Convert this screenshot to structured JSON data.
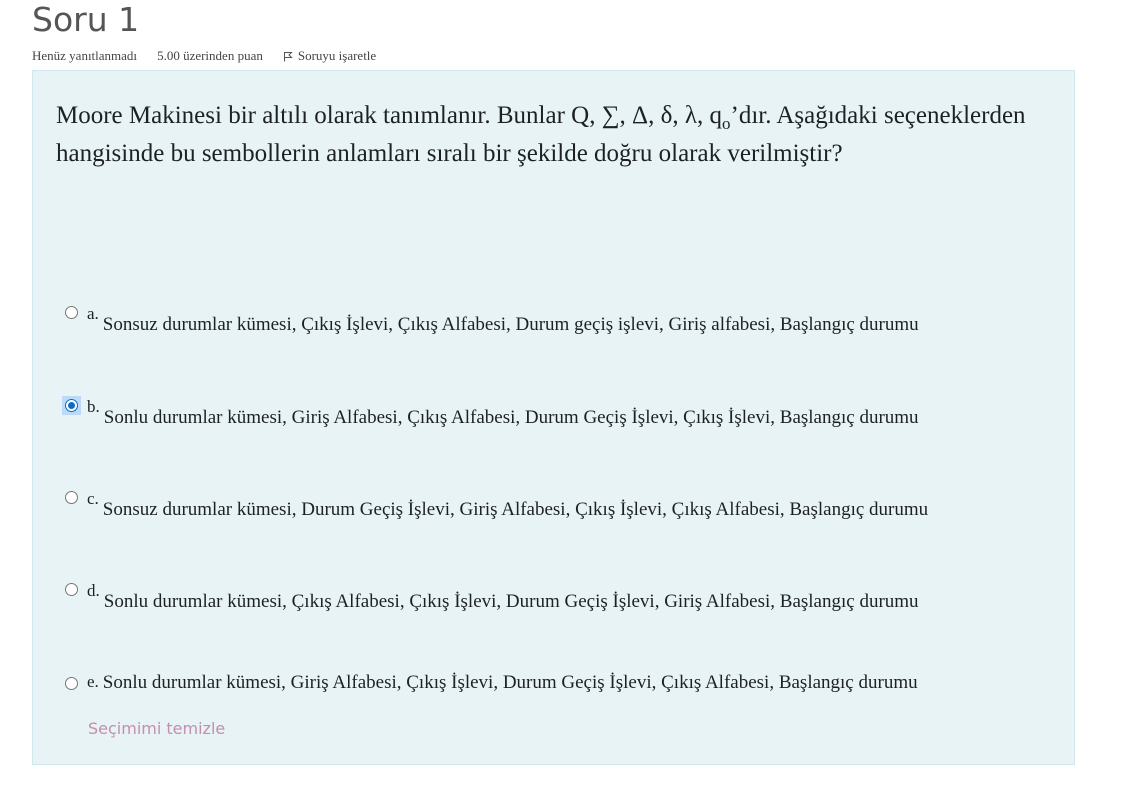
{
  "question": {
    "title": "Soru 1",
    "status": "Henüz yanıtlanmadı",
    "points": "5.00 üzerinden puan",
    "flag_label": "Soruyu işaretle",
    "text_before_sub": "Moore Makinesi bir altılı olarak tanımlanır. Bunlar Q, ∑, Δ, δ, λ, q",
    "text_sub": "o",
    "text_after_sub": "’dır. Aşağıdaki seçeneklerden hangisinde bu sembollerin anlamları sıralı bir şekilde doğru olarak verilmiştir?"
  },
  "options": [
    {
      "letter": "a.",
      "text": "Sonsuz durumlar kümesi, Çıkış İşlevi, Çıkış Alfabesi, Durum geçiş işlevi, Giriş alfabesi, Başlangıç durumu",
      "selected": false
    },
    {
      "letter": "b.",
      "text": "Sonlu durumlar kümesi, Giriş Alfabesi, Çıkış Alfabesi, Durum Geçiş İşlevi, Çıkış İşlevi, Başlangıç durumu",
      "selected": true
    },
    {
      "letter": "c.",
      "text": "Sonsuz durumlar kümesi, Durum Geçiş İşlevi, Giriş Alfabesi, Çıkış İşlevi, Çıkış Alfabesi, Başlangıç durumu",
      "selected": false
    },
    {
      "letter": "d.",
      "text": "Sonlu durumlar kümesi, Çıkış Alfabesi, Çıkış İşlevi, Durum Geçiş İşlevi, Giriş Alfabesi, Başlangıç durumu",
      "selected": false
    },
    {
      "letter": "e.",
      "text": "Sonlu durumlar kümesi, Giriş Alfabesi, Çıkış İşlevi, Durum Geçiş İşlevi, Çıkış Alfabesi, Başlangıç durumu",
      "selected": false
    }
  ],
  "clear_label": "Seçimimi temizle",
  "icons": {
    "flag": "flag-icon"
  },
  "colors": {
    "accent": "#0f6cbf",
    "panel_bg": "#e7f3f5",
    "clear_link": "#c38fb1"
  }
}
